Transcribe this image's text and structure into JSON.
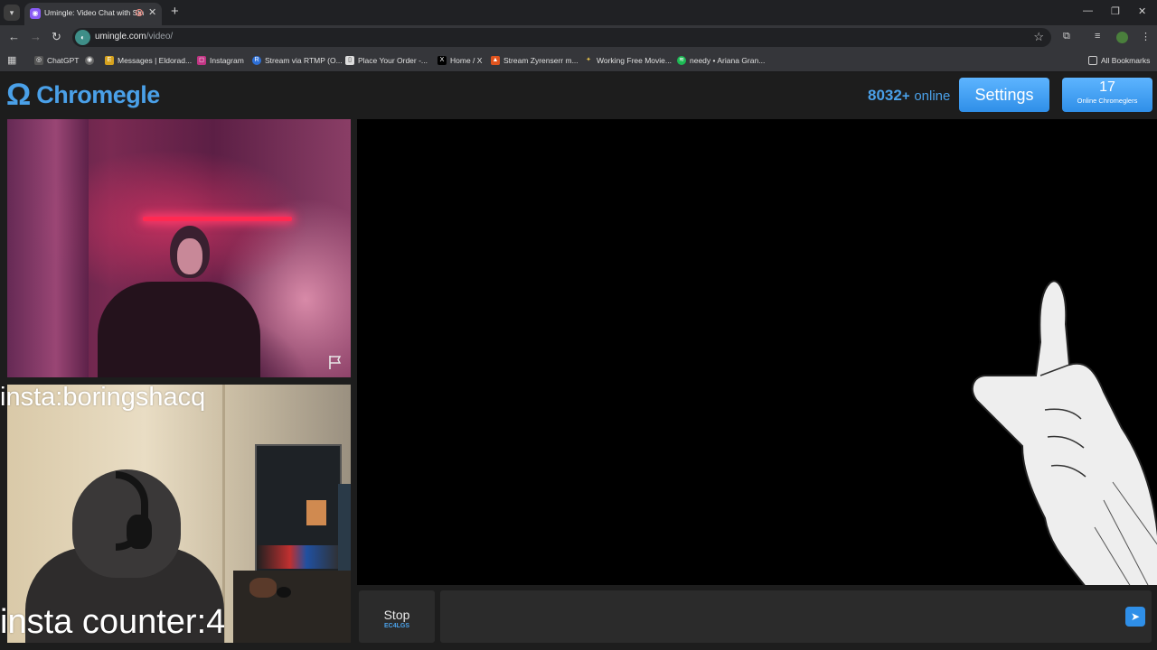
{
  "browser": {
    "tab_title": "Umingle: Video Chat with Strangers",
    "url_domain": "umingle.com",
    "url_path": "/video/",
    "bookmarks": [
      {
        "label": "ChatGPT"
      },
      {
        "label": ""
      },
      {
        "label": "Messages | Eldorad..."
      },
      {
        "label": "Instagram"
      },
      {
        "label": "Stream via RTMP (O..."
      },
      {
        "label": "Place Your Order -..."
      },
      {
        "label": "Home / X"
      },
      {
        "label": "Stream Zyrenserr m..."
      },
      {
        "label": "Working Free Movie..."
      },
      {
        "label": "needy • Ariana Gran..."
      }
    ],
    "all_bookmarks_label": "All Bookmarks"
  },
  "app": {
    "logo_symbol": "Ω",
    "logo_text": "Chromegle",
    "online_count": "8032",
    "online_plus": "+",
    "online_label": "online",
    "settings_label": "Settings",
    "chromeglers_count": "17",
    "chromeglers_label": "Online Chromeglers"
  },
  "overlays": {
    "insta_handle": "insta:boringshacq",
    "insta_counter": "insta counter:4"
  },
  "controls": {
    "stop_label": "Stop",
    "stop_sub": "EC4LGS",
    "chat_value": "",
    "send_icon": "send-icon"
  },
  "colors": {
    "accent": "#4aa0e8",
    "button": "#2f8fe8",
    "background": "#1d1d1d"
  }
}
